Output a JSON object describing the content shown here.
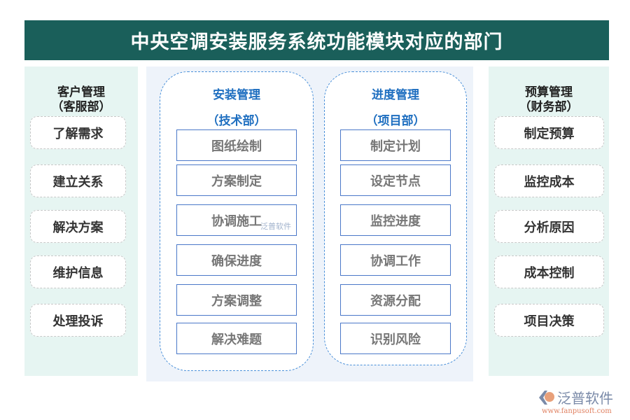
{
  "title": "中央空调安装服务系统功能模块对应的部门",
  "left": {
    "head1": "客户管理",
    "head2": "（客服部）",
    "items": [
      "了解需求",
      "建立关系",
      "解决方案",
      "维护信息",
      "处理投诉"
    ]
  },
  "col1": {
    "head1": "安装管理",
    "head2": "（技术部）",
    "items": [
      "图纸绘制",
      "方案制定",
      "协调施工",
      "确保进度",
      "方案调整",
      "解决难题"
    ]
  },
  "col2": {
    "head1": "进度管理",
    "head2": "（项目部）",
    "items": [
      "制定计划",
      "设定节点",
      "监控进度",
      "协调工作",
      "资源分配",
      "识别风险"
    ]
  },
  "right": {
    "head1": "预算管理",
    "head2": "（财务部）",
    "items": [
      "制定预算",
      "监控成本",
      "分析原因",
      "成本控制",
      "项目决策"
    ]
  },
  "watermark": "泛普软件",
  "logo": {
    "name": "泛普软件",
    "url": "www.fanpusoft.com"
  },
  "colors": {
    "header": "#1a5f5a",
    "side": "#e6f5f2",
    "center": "#eef3fa",
    "accent": "#1f6fc0"
  }
}
